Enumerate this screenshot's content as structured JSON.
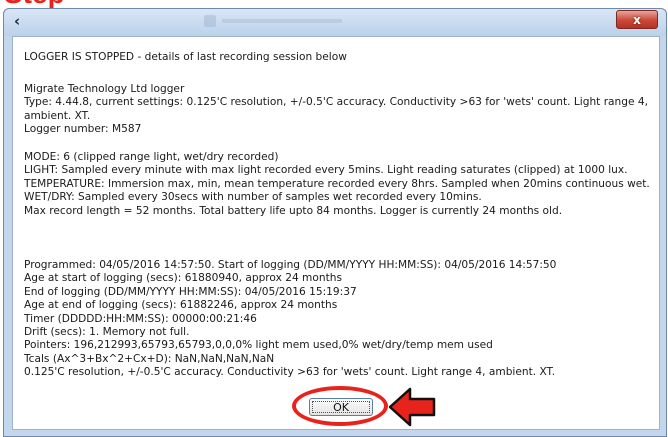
{
  "window": {
    "title_icon": "app-icon",
    "close_glyph": "x"
  },
  "annotations": {
    "color": "#e8231c",
    "ok_highlight": "ellipse",
    "arrow": "arrow-pointing-left"
  },
  "status_line": "LOGGER IS STOPPED - details of last recording session below",
  "logger_info": [
    "Migrate Technology Ltd logger",
    "Type: 4.44.8, current settings: 0.125'C resolution, +/-0.5'C accuracy. Conductivity >63 for 'wets' count. Light range 4, ambient. XT.",
    "Logger number: M587"
  ],
  "mode_info": [
    "MODE: 6 (clipped range light, wet/dry recorded)",
    "LIGHT: Sampled every minute with max light recorded every 5mins. Light reading saturates (clipped) at 1000 lux.",
    "TEMPERATURE: Immersion max, min, mean temperature recorded every 8hrs. Sampled when 20mins continuous wet.",
    "WET/DRY: Sampled every 30secs with number of samples wet recorded every 10mins.",
    "Max record length = 52 months. Total battery life upto 84 months. Logger is currently 24 months old."
  ],
  "session_info": [
    "Programmed: 04/05/2016 14:57:50. Start of logging (DD/MM/YYYY HH:MM:SS): 04/05/2016 14:57:50",
    "Age at start of logging (secs): 61880940, approx 24 months",
    "End of logging (DD/MM/YYYY HH:MM:SS): 04/05/2016 15:19:37",
    "Age at end of logging (secs): 61882246, approx 24 months",
    "Timer (DDDDD:HH:MM:SS): 00000:00:21:46",
    "Drift (secs): 1. Memory not full.",
    "Pointers: 196,212993,65793,65793,0,0,0% light mem used,0% wet/dry/temp mem used",
    "Tcals (Ax^3+Bx^2+Cx+D): NaN,NaN,NaN,NaN",
    "0.125'C resolution, +/-0.5'C accuracy. Conductivity >63 for 'wets' count. Light range 4, ambient. XT."
  ],
  "buttons": {
    "ok_label": "OK"
  }
}
